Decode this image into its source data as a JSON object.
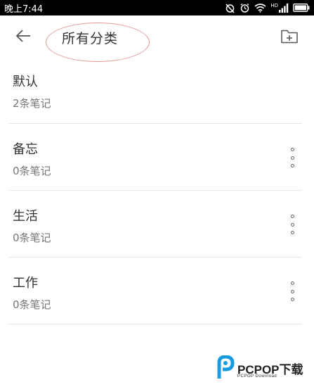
{
  "status_bar": {
    "time": "晚上7:44",
    "icons": [
      "alarm-off-icon",
      "alarm-icon",
      "wifi-icon",
      "hd-signal-icon",
      "battery-icon"
    ],
    "hd_label": "HD"
  },
  "header": {
    "title": "所有分类",
    "back_icon": "arrow-left-icon",
    "add_icon": "folder-add-icon",
    "annotation_color": "#e39a9a"
  },
  "categories": [
    {
      "name": "默认",
      "count": "2条笔记",
      "has_menu": false
    },
    {
      "name": "备忘",
      "count": "0条笔记",
      "has_menu": true
    },
    {
      "name": "生活",
      "count": "0条笔记",
      "has_menu": true
    },
    {
      "name": "工作",
      "count": "0条笔记",
      "has_menu": true
    }
  ],
  "watermark": {
    "brand": "PCPOP下载",
    "sub": "PCPOP Download",
    "accent": "#1a9be0"
  }
}
